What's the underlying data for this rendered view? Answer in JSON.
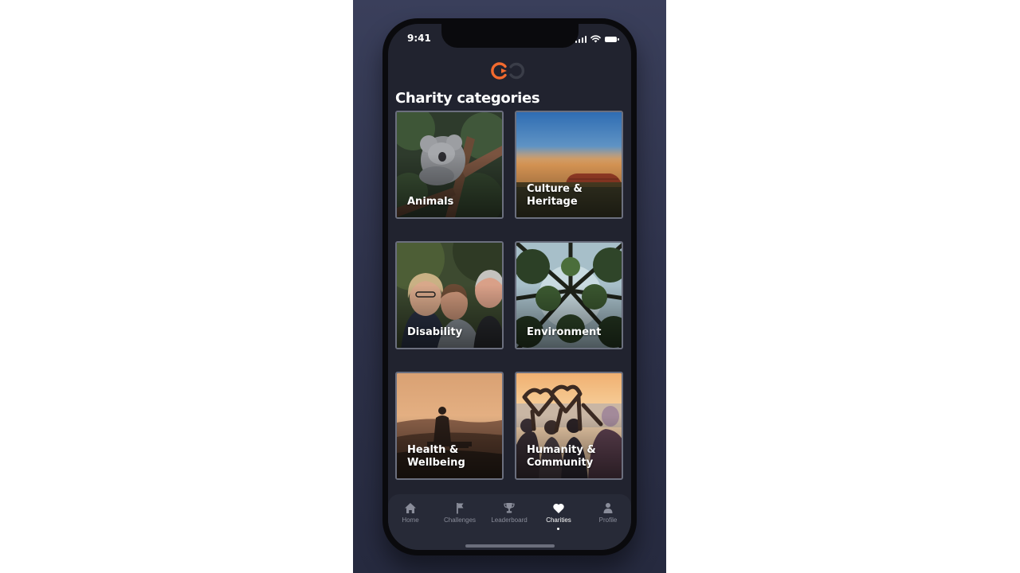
{
  "status_bar": {
    "time": "9:41"
  },
  "page": {
    "title": "Charity categories"
  },
  "categories": [
    {
      "label": "Animals"
    },
    {
      "label": "Culture &\nHeritage"
    },
    {
      "label": "Disability"
    },
    {
      "label": "Environment"
    },
    {
      "label": "Health &\nWellbeing"
    },
    {
      "label": "Humanity &\nCommunity"
    }
  ],
  "tab_bar": {
    "tabs": [
      {
        "label": "Home",
        "icon": "home-icon"
      },
      {
        "label": "Challenges",
        "icon": "flag-icon"
      },
      {
        "label": "Leaderboard",
        "icon": "trophy-icon"
      },
      {
        "label": "Charities",
        "icon": "heart-icon",
        "active": true
      },
      {
        "label": "Profile",
        "icon": "person-icon"
      }
    ]
  },
  "colors": {
    "brand_accent": "#f26a2e",
    "background": "#21232f",
    "tab_inactive": "#8a8d9a",
    "tab_active": "#ffffff"
  }
}
